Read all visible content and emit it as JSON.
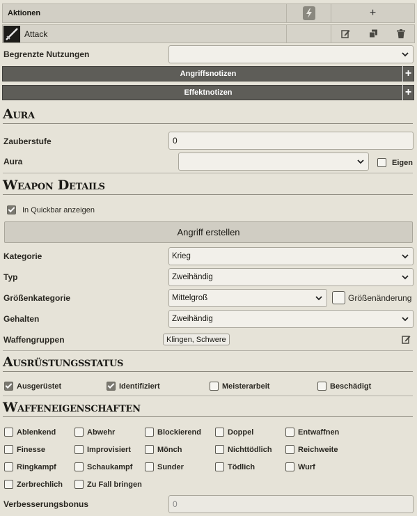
{
  "actions": {
    "header": "Aktionen",
    "add_symbol": "+",
    "attack_name": "Attack"
  },
  "limited_uses_label": "Begrenzte Nutzungen",
  "attack_notes": "Angriffsnotizen",
  "effect_notes": "Effektnotizen",
  "aura_section": {
    "title": "Aura",
    "caster_level_label": "Zauberstufe",
    "caster_level_value": "0",
    "aura_label": "Aura",
    "custom_label": "Eigen"
  },
  "weapon_details": {
    "title": "Weapon Details",
    "quickbar_label": "In Quickbar anzeigen",
    "create_attack_label": "Angriff erstellen",
    "category_label": "Kategorie",
    "category_value": "Krieg",
    "type_label": "Typ",
    "type_value": "Zweihändig",
    "size_label": "Größenkategorie",
    "size_value": "Mittelgroß",
    "resize_label": "Größenänderung",
    "held_label": "Gehalten",
    "held_value": "Zweihändig",
    "groups_label": "Waffengruppen",
    "groups_value": "Klingen, Schwere"
  },
  "equipment_status": {
    "title": "Ausrüstungsstatus",
    "equipped": "Ausgerüstet",
    "identified": "Identifiziert",
    "masterwork": "Meisterarbeit",
    "broken": "Beschädigt"
  },
  "weapon_properties": {
    "title": "Waffeneigenschaften",
    "items": [
      "Ablenkend",
      "Abwehr",
      "Blockierend",
      "Doppel",
      "Entwaffnen",
      "Finesse",
      "Improvisiert",
      "Mönch",
      "Nichttödlich",
      "Reichweite",
      "Ringkampf",
      "Schaukampf",
      "Sunder",
      "Tödlich",
      "Wurf",
      "Zerbrechlich",
      "Zu Fall bringen"
    ]
  },
  "enhancement": {
    "label": "Verbesserungsbonus",
    "value": "0"
  }
}
